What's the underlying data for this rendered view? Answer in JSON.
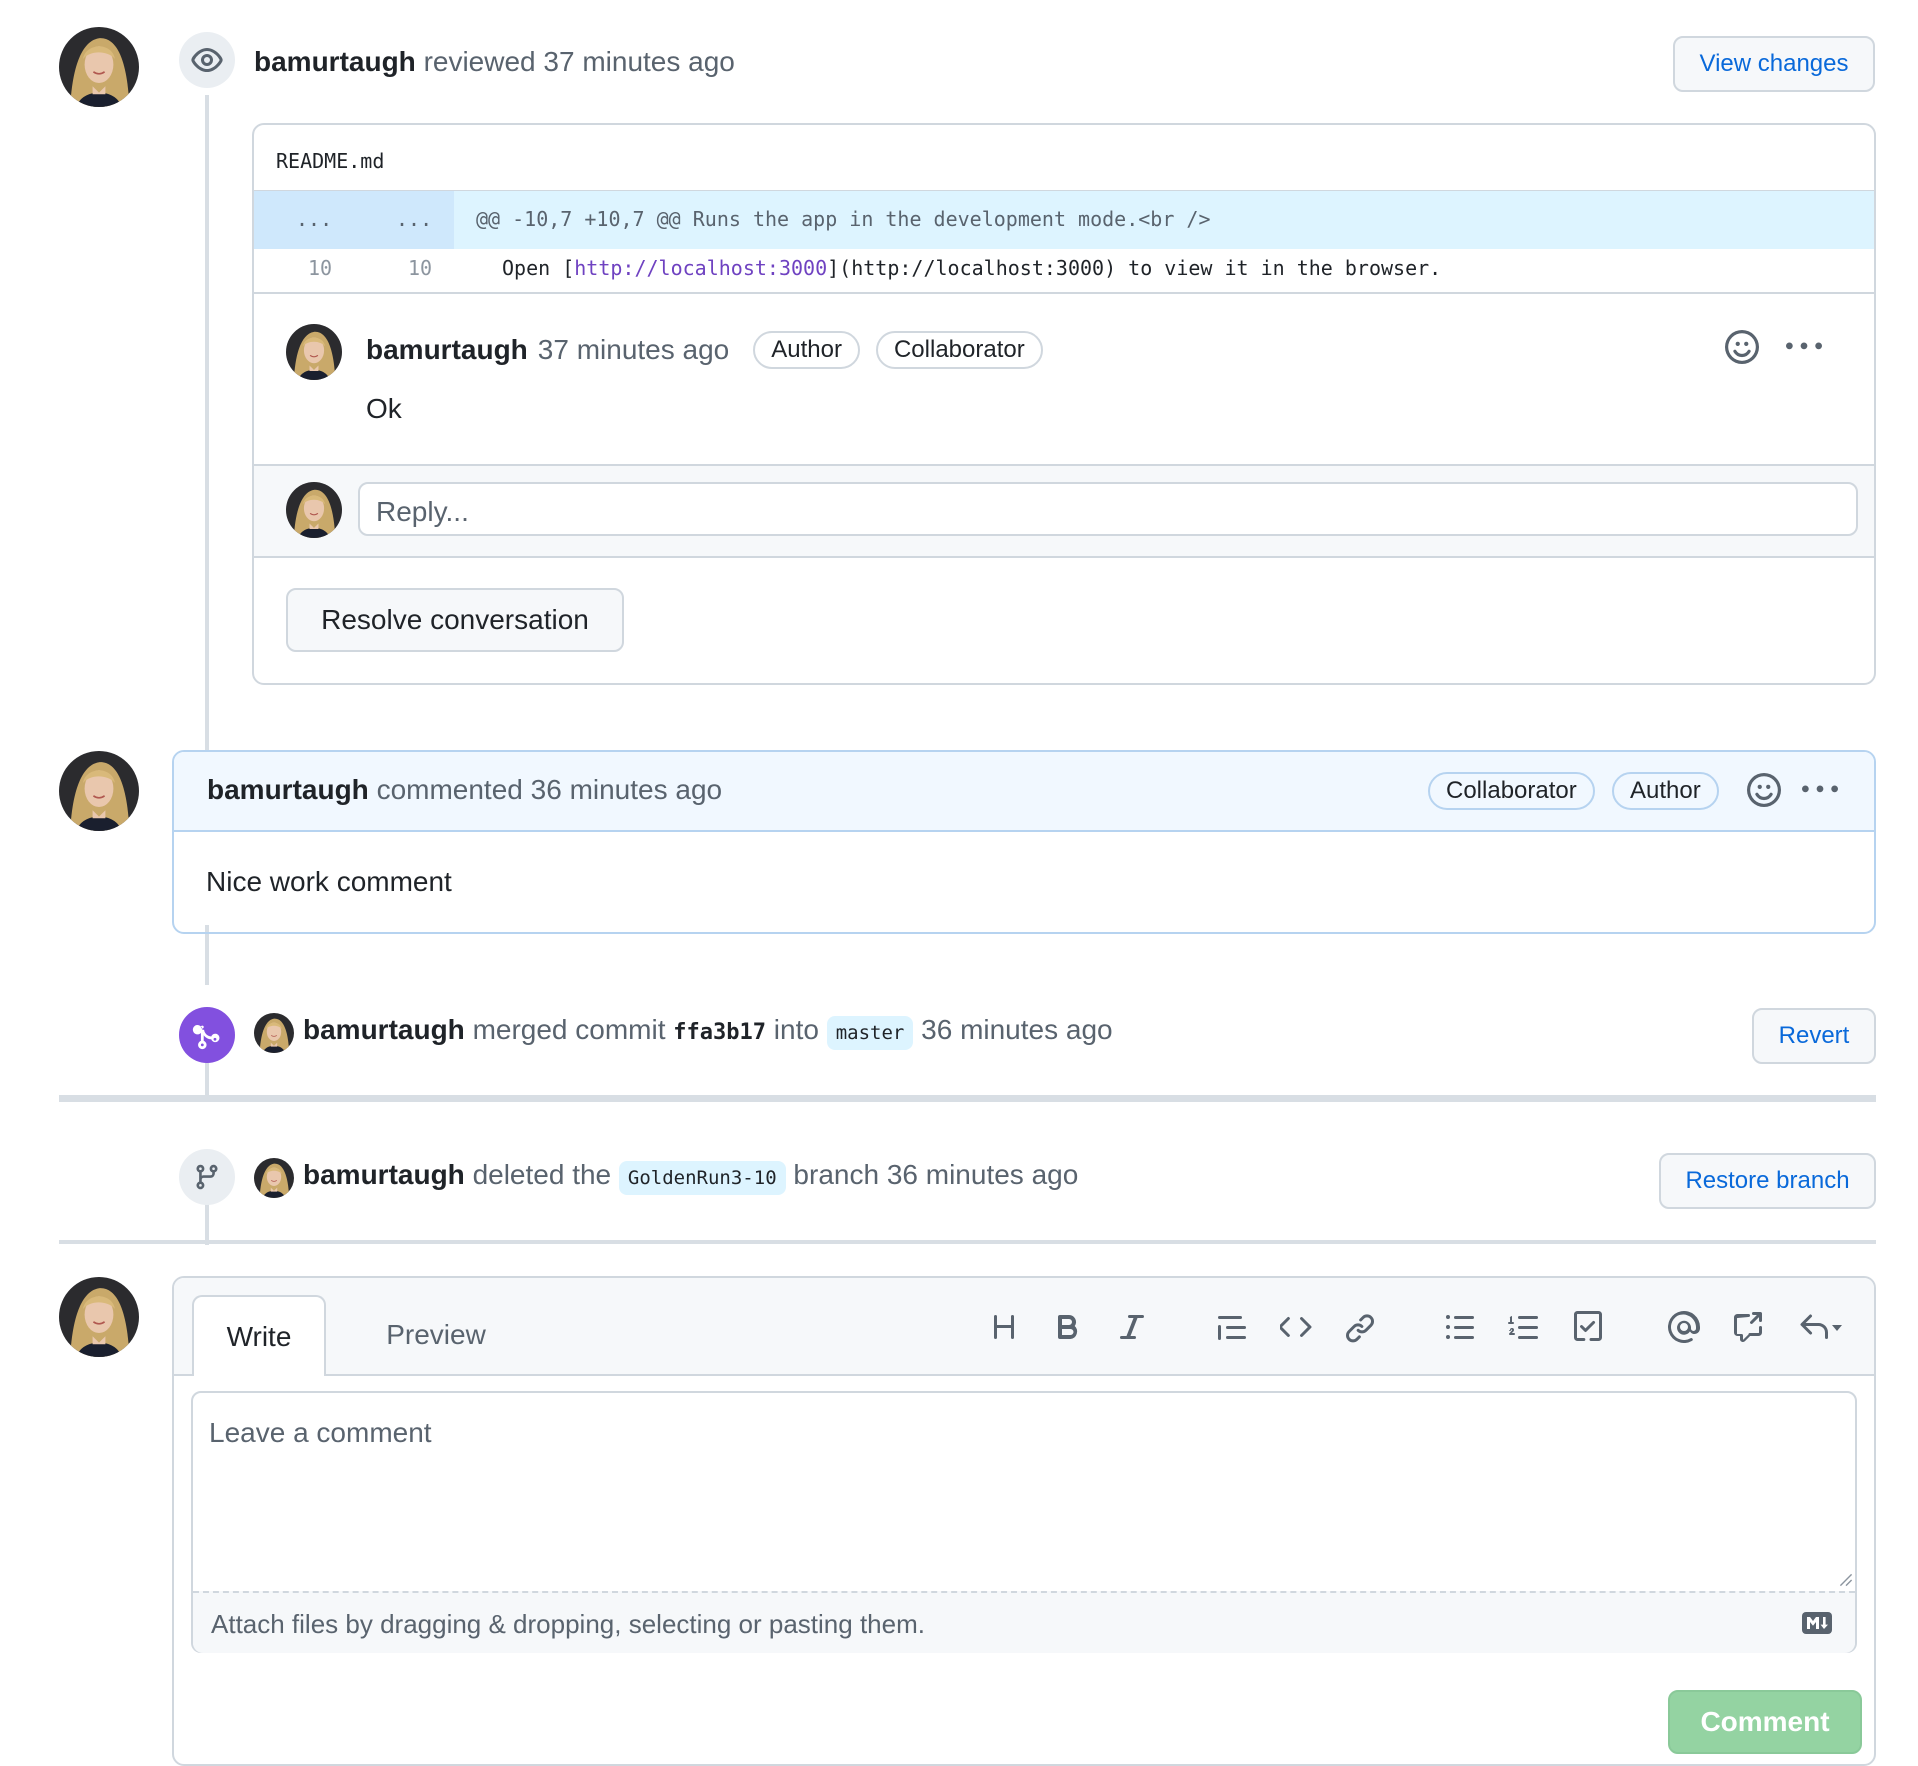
{
  "user": "bamurtaugh",
  "review": {
    "action": "reviewed",
    "time": "37 minutes ago",
    "view_changes": "View changes",
    "file": "README.md",
    "hunk_left": "...",
    "hunk_right": "...",
    "hunk_header": "@@ -10,7 +10,7 @@ Runs the app in the development mode.<br />",
    "line_left": "10",
    "line_right": "10",
    "line_code_pre": "Open [",
    "line_code_link": "http://localhost:3000",
    "line_code_post": "](http://localhost:3000) to view it in the browser.",
    "comment": {
      "time": "37 minutes ago",
      "badge1": "Author",
      "badge2": "Collaborator",
      "body": "Ok"
    },
    "reply_placeholder": "Reply...",
    "resolve": "Resolve conversation"
  },
  "comment": {
    "action": "commented",
    "time": "36 minutes ago",
    "badge1": "Collaborator",
    "badge2": "Author",
    "body": "Nice work comment"
  },
  "merge": {
    "text1": "merged commit",
    "sha": "ffa3b17",
    "text2": "into",
    "branch": "master",
    "time": "36 minutes ago",
    "button": "Revert"
  },
  "deleted": {
    "text1": "deleted the",
    "branch": "GoldenRun3-10",
    "text2": "branch",
    "time": "36 minutes ago",
    "button": "Restore branch"
  },
  "composer": {
    "tab_write": "Write",
    "tab_preview": "Preview",
    "placeholder": "Leave a comment",
    "attach": "Attach files by dragging & dropping, selecting or pasting them.",
    "submit": "Comment",
    "toolbar": [
      "heading-icon",
      "bold-icon",
      "italic-icon",
      "quote-icon",
      "code-icon",
      "link-icon",
      "bullet-list-icon",
      "numbered-list-icon",
      "task-list-icon",
      "mention-icon",
      "cross-reference-icon",
      "saved-reply-icon"
    ]
  },
  "colors": {
    "accent": "#0969da",
    "merged": "#8250df",
    "comment_button": "#94d3a2"
  }
}
